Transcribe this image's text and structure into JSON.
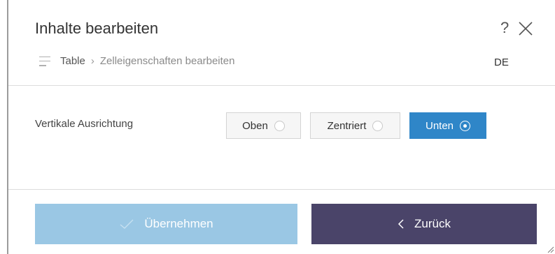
{
  "dialog": {
    "title": "Inhalte bearbeiten",
    "help_label": "?",
    "language": "DE"
  },
  "breadcrumb": {
    "root": "Table",
    "separator": "›",
    "current": "Zelleigenschaften bearbeiten"
  },
  "vertical_alignment": {
    "label": "Vertikale Ausrichtung",
    "options": [
      {
        "label": "Oben",
        "selected": false
      },
      {
        "label": "Zentriert",
        "selected": false
      },
      {
        "label": "Unten",
        "selected": true
      }
    ]
  },
  "footer": {
    "apply_label": "Übernehmen",
    "back_label": "Zurück"
  },
  "colors": {
    "selected_option": "#2f86c8",
    "apply_button": "#9ac7e4",
    "back_button": "#4a4469"
  },
  "icons": {
    "help": "help-icon",
    "close": "close-icon",
    "breadcrumb_menu": "menu-lines-icon",
    "apply": "checkmark-icon",
    "back": "chevron-left-icon",
    "resize": "resize-grip-icon"
  }
}
